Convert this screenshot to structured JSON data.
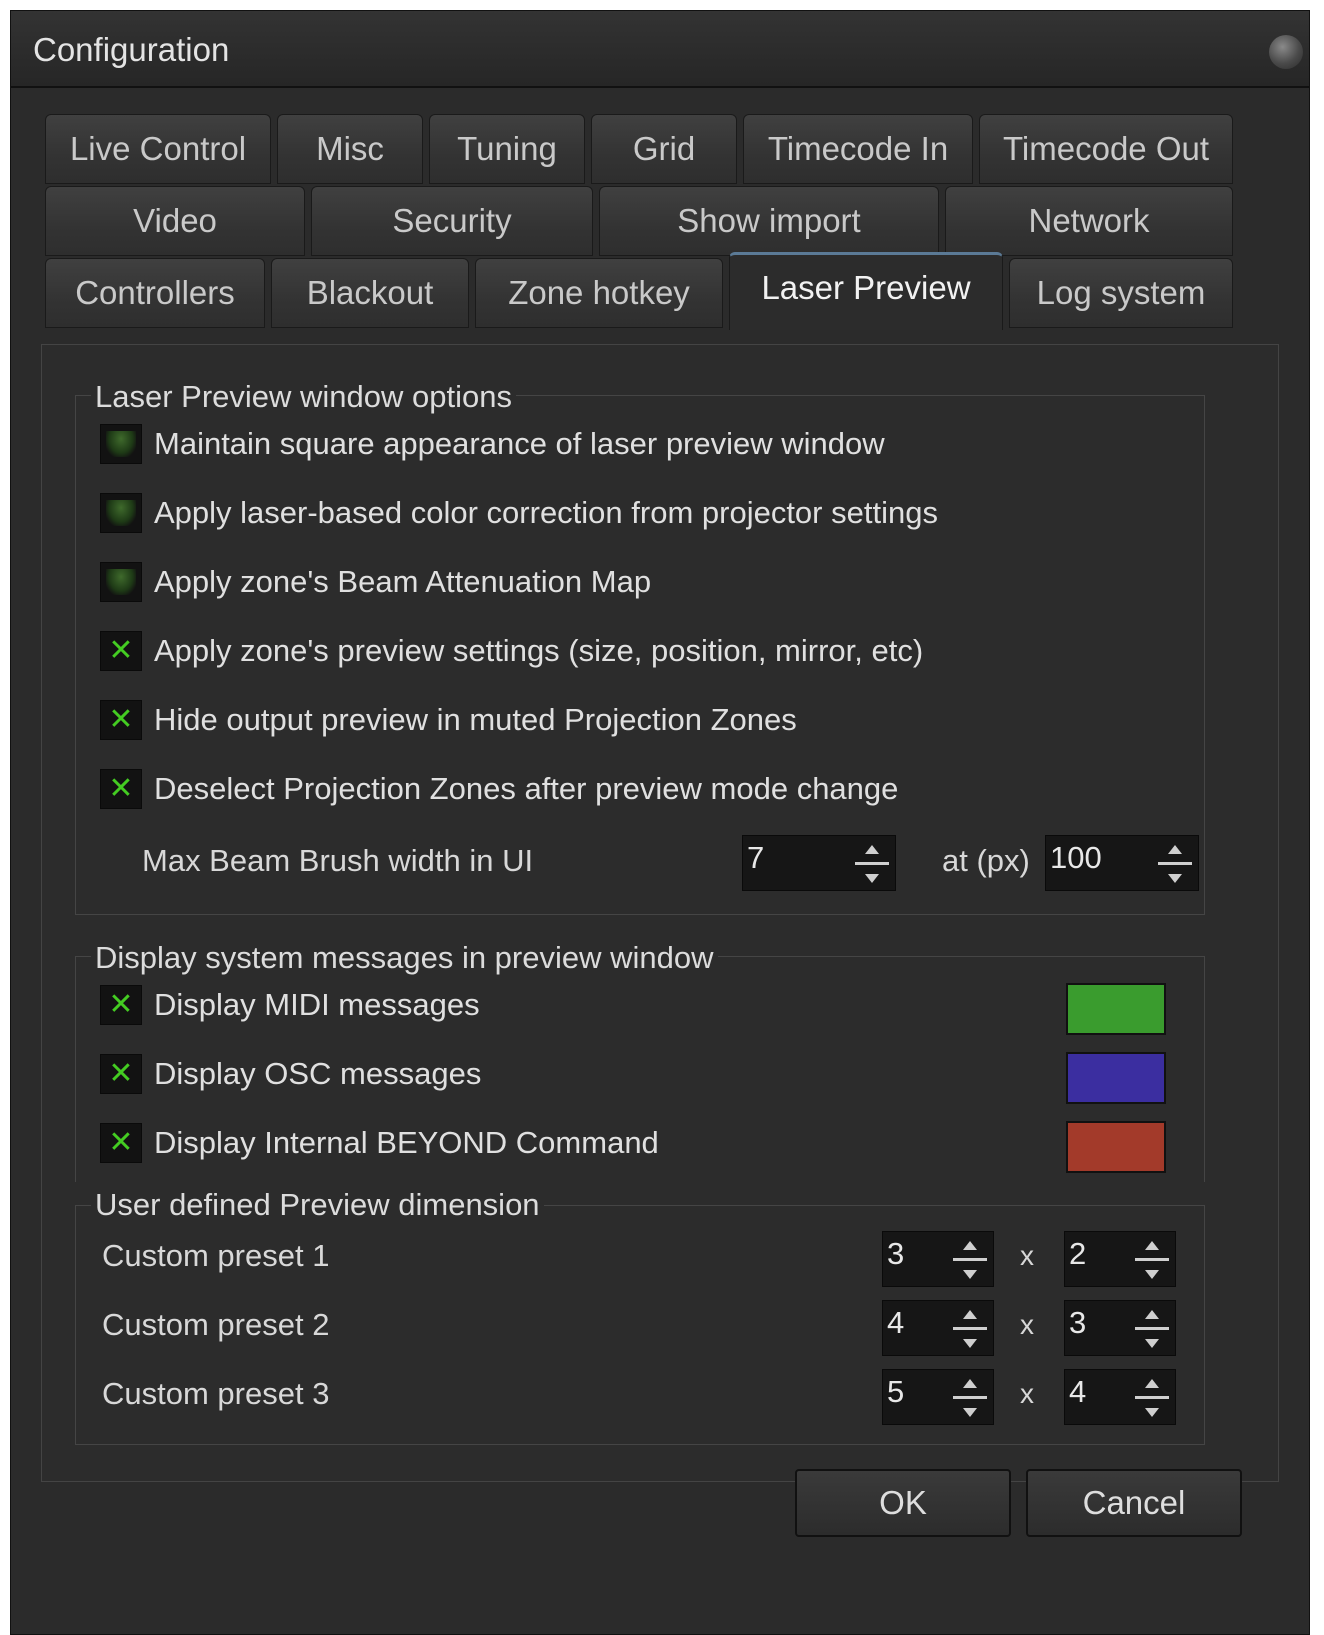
{
  "window": {
    "title": "Configuration"
  },
  "tabs": [
    {
      "label": "Live Control"
    },
    {
      "label": "Misc"
    },
    {
      "label": "Tuning"
    },
    {
      "label": "Grid"
    },
    {
      "label": "Timecode In"
    },
    {
      "label": "Timecode Out"
    },
    {
      "label": "Video"
    },
    {
      "label": "Security"
    },
    {
      "label": "Show import"
    },
    {
      "label": "Network"
    },
    {
      "label": "Controllers"
    },
    {
      "label": "Blackout"
    },
    {
      "label": "Zone hotkey"
    },
    {
      "label": "Laser Preview",
      "active": true
    },
    {
      "label": "Log system"
    }
  ],
  "preview_options": {
    "title": "Laser Preview window options",
    "checkboxes": [
      {
        "label": "Maintain square appearance of laser preview window",
        "checked": false
      },
      {
        "label": "Apply laser-based color correction from projector settings",
        "checked": false
      },
      {
        "label": "Apply zone's Beam Attenuation Map",
        "checked": false
      },
      {
        "label": "Apply zone's preview settings (size, position, mirror, etc)",
        "checked": true
      },
      {
        "label": "Hide output preview in muted Projection Zones",
        "checked": true
      },
      {
        "label": "Deselect Projection Zones after preview mode change",
        "checked": true
      }
    ],
    "brush_label": "Max Beam Brush width in UI",
    "brush_width": "7",
    "at_label": "at (px)",
    "at_value": "100"
  },
  "system_messages": {
    "title": "Display system messages in preview window",
    "items": [
      {
        "label": "Display MIDI messages",
        "checked": true,
        "color": "#3a9c2e"
      },
      {
        "label": "Display OSC messages",
        "checked": true,
        "color": "#3b2ea0"
      },
      {
        "label": "Display Internal BEYOND Command",
        "checked": true,
        "color": "#a33a2a"
      }
    ]
  },
  "dimensions": {
    "title": "User defined Preview dimension",
    "separator": "x",
    "presets": [
      {
        "label": "Custom preset 1",
        "w": "3",
        "h": "2"
      },
      {
        "label": "Custom preset 2",
        "w": "4",
        "h": "3"
      },
      {
        "label": "Custom preset 3",
        "w": "5",
        "h": "4"
      }
    ]
  },
  "buttons": {
    "ok": "OK",
    "cancel": "Cancel"
  }
}
